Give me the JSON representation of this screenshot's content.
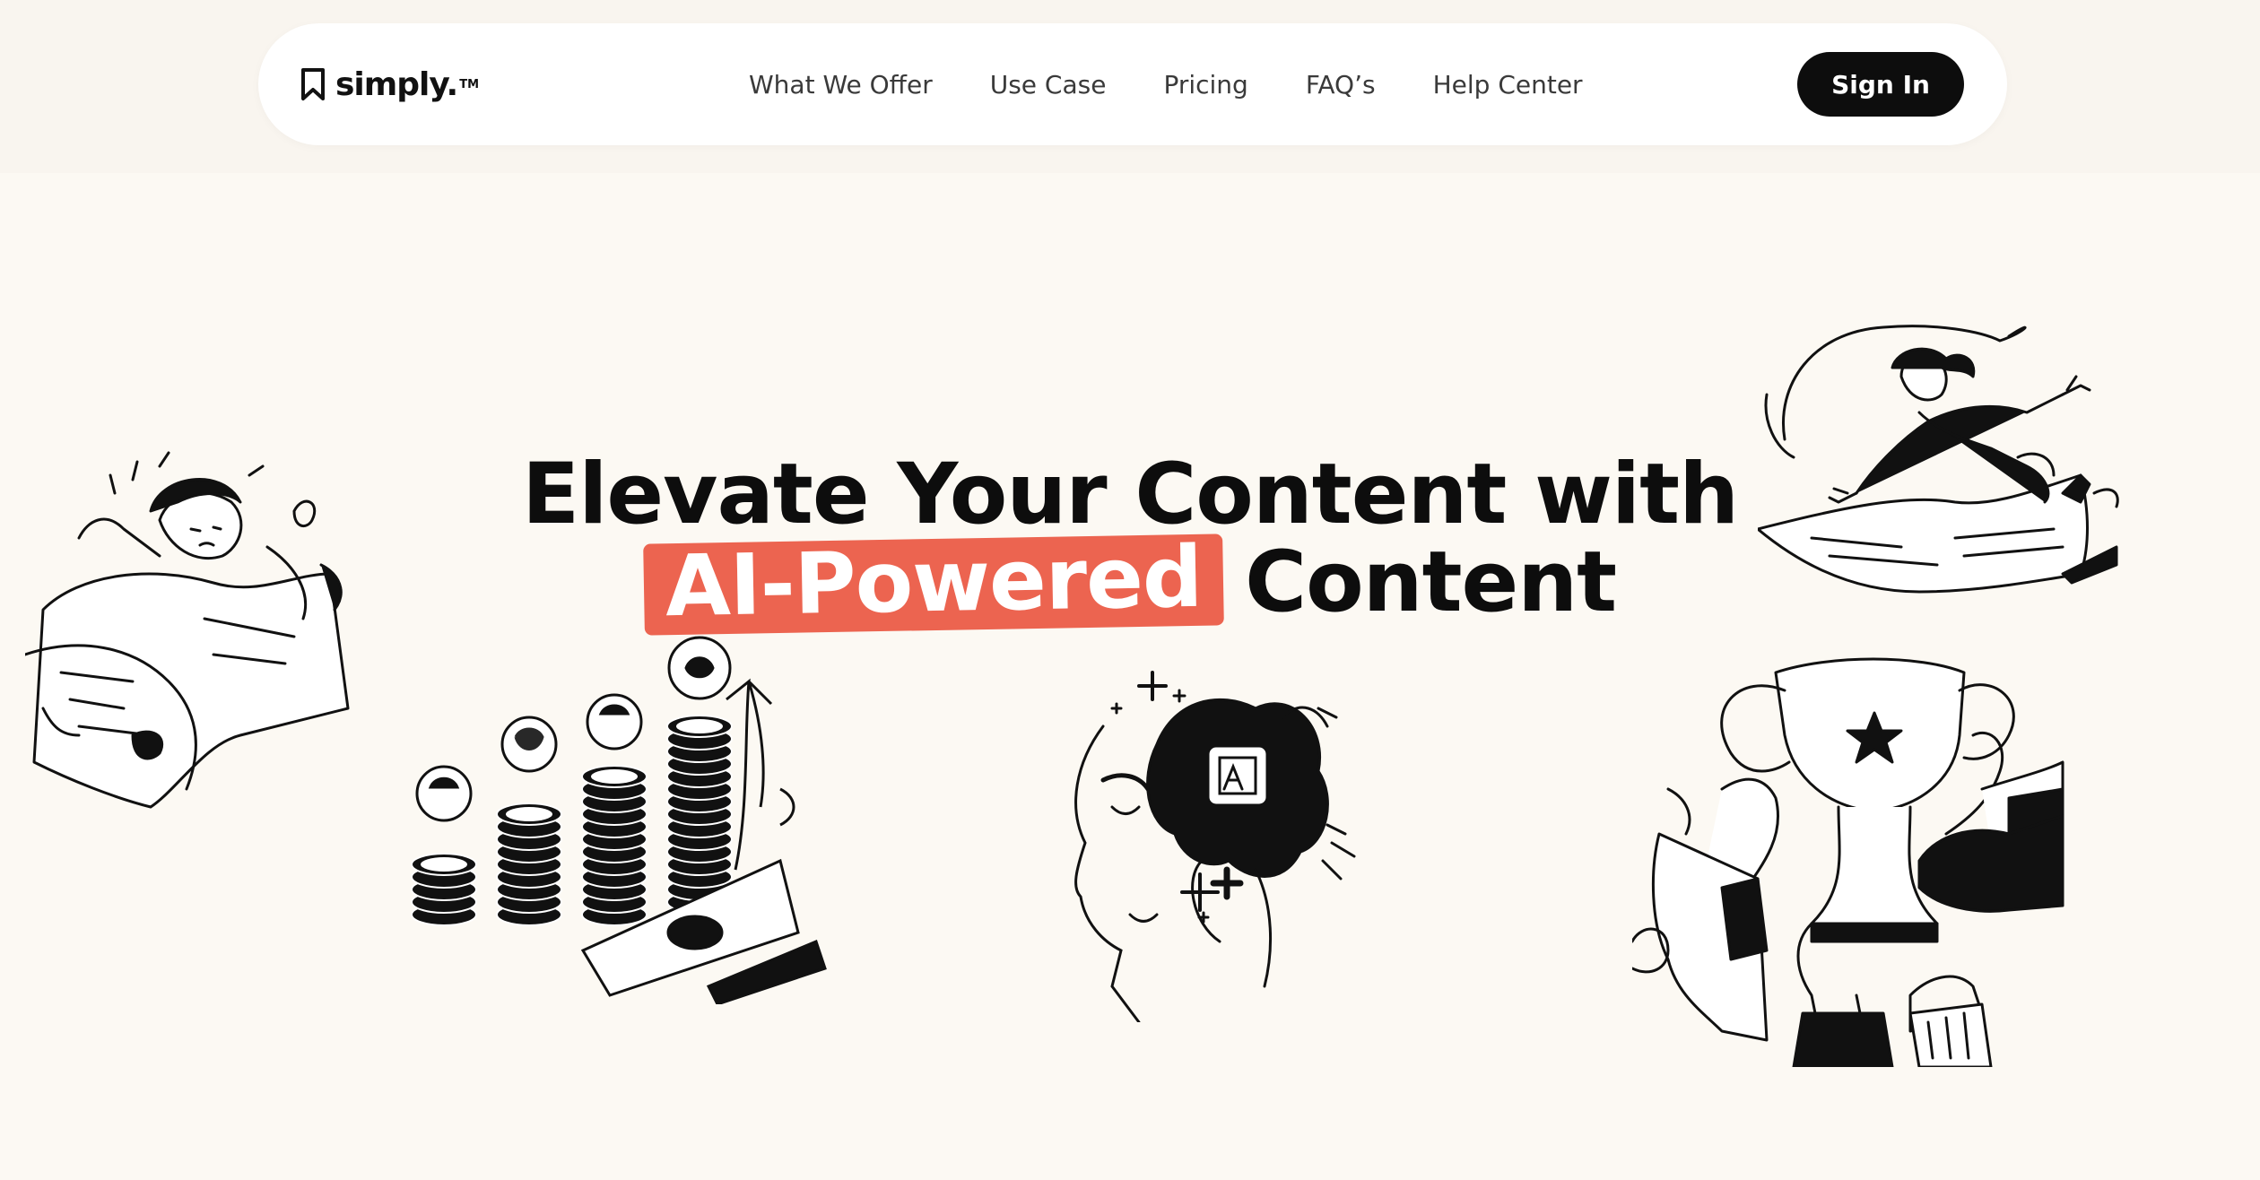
{
  "brand": {
    "name": "simply.",
    "trademark": "TM"
  },
  "nav": {
    "links": [
      {
        "label": "What We Offer"
      },
      {
        "label": "Use Case"
      },
      {
        "label": "Pricing"
      },
      {
        "label": "FAQ’s"
      },
      {
        "label": "Help Center"
      }
    ],
    "signin_label": "Sign In"
  },
  "hero": {
    "line1": "Elevate Your Content with",
    "highlight": "AI-Powered",
    "line2_rest": "Content"
  },
  "colors": {
    "accent": "#ec6450",
    "background": "#fcf9f3",
    "dark": "#0d0d0d"
  },
  "illustrations": [
    {
      "icon": "stressed-person-with-receipt-illustration"
    },
    {
      "icon": "coin-stacks-growth-illustration"
    },
    {
      "icon": "ai-brain-chip-illustration"
    },
    {
      "icon": "trophy-hands-illustration"
    },
    {
      "icon": "flying-person-on-paper-illustration"
    }
  ]
}
